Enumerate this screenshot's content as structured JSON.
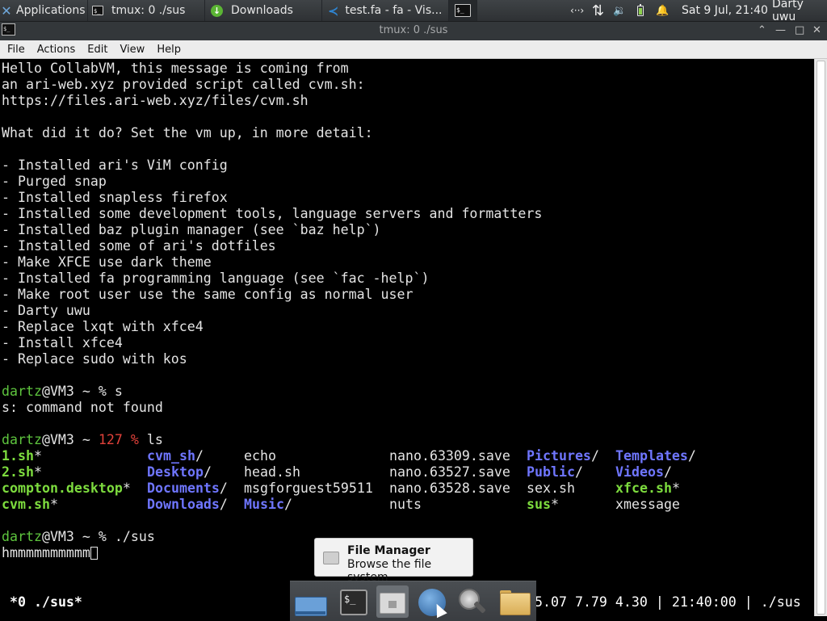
{
  "panel": {
    "applications_label": "Applications",
    "tasks": [
      {
        "label": "tmux: 0 ./sus",
        "icon": "terminal-icon"
      },
      {
        "label": "Downloads",
        "icon": "download-icon"
      },
      {
        "label": "test.fa - fa - Vis...",
        "icon": "vscode-icon"
      },
      {
        "label": "",
        "icon": "terminal-icon"
      }
    ],
    "tray": {
      "network": "‹··›",
      "transfer": "⇅",
      "volume": "🔉",
      "bell": "🔔",
      "clock": "Sat  9 Jul, 21:40",
      "user": "Darty uwu"
    }
  },
  "window": {
    "title": "tmux: 0 ./sus",
    "controls": {
      "shade": "⌃",
      "minimize": "—",
      "maximize": "□",
      "close": "✕"
    }
  },
  "menu": [
    "File",
    "Actions",
    "Edit",
    "View",
    "Help"
  ],
  "terminal": {
    "lines": [
      "Hello CollabVM, this message is coming from",
      "an ari-web.xyz provided script called cvm.sh:",
      "https://files.ari-web.xyz/files/cvm.sh",
      "",
      "What did it do? Set the vm up, in more detail:",
      "",
      "- Installed ari's ViM config",
      "- Purged snap",
      "- Installed snapless firefox",
      "- Installed some development tools, language servers and formatters",
      "- Installed baz plugin manager (see `baz help`)",
      "- Installed some of ari's dotfiles",
      "- Make XFCE use dark theme",
      "- Installed fa programming language (see `fac -help`)",
      "- Make root user use the same config as normal user",
      "- Darty uwu",
      "- Replace lxqt with xfce4",
      "- Install xfce4",
      "- Replace sudo with kos"
    ],
    "prompt1": {
      "user": "dartz",
      "rest": "@VM3 ~ % s"
    },
    "error_line": "s: command not found",
    "prompt2": {
      "user": "dartz",
      "mid": "@VM3 ~ ",
      "code": "127 %",
      "cmd": " ls"
    },
    "ls_columns": [
      [
        {
          "name": "1.sh",
          "suffix": "*",
          "kind": "exe"
        },
        {
          "name": "2.sh",
          "suffix": "*",
          "kind": "exe"
        },
        {
          "name": "compton.desktop",
          "suffix": "*",
          "kind": "exe"
        },
        {
          "name": "cvm.sh",
          "suffix": "*",
          "kind": "exe"
        }
      ],
      [
        {
          "name": "cvm_sh",
          "suffix": "/",
          "kind": "dir"
        },
        {
          "name": "Desktop",
          "suffix": "/",
          "kind": "dir"
        },
        {
          "name": "Documents",
          "suffix": "/",
          "kind": "dir"
        },
        {
          "name": "Downloads",
          "suffix": "/",
          "kind": "dir"
        }
      ],
      [
        {
          "name": "echo",
          "suffix": "",
          "kind": "plain"
        },
        {
          "name": "head.sh",
          "suffix": "",
          "kind": "plain"
        },
        {
          "name": "msgforguest59511",
          "suffix": "",
          "kind": "plain"
        },
        {
          "name": "Music",
          "suffix": "/",
          "kind": "dir"
        }
      ],
      [
        {
          "name": "nano.63309.save",
          "suffix": "",
          "kind": "plain"
        },
        {
          "name": "nano.63527.save",
          "suffix": "",
          "kind": "plain"
        },
        {
          "name": "nano.63528.save",
          "suffix": "",
          "kind": "plain"
        },
        {
          "name": "nuts",
          "suffix": "",
          "kind": "plain"
        }
      ],
      [
        {
          "name": "Pictures",
          "suffix": "/",
          "kind": "dir"
        },
        {
          "name": "Public",
          "suffix": "/",
          "kind": "dir"
        },
        {
          "name": "sex.sh",
          "suffix": "",
          "kind": "plain"
        },
        {
          "name": "sus",
          "suffix": "*",
          "kind": "exe"
        }
      ],
      [
        {
          "name": "Templates",
          "suffix": "/",
          "kind": "dir"
        },
        {
          "name": "Videos",
          "suffix": "/",
          "kind": "dir"
        },
        {
          "name": "xfce.sh",
          "suffix": "*",
          "kind": "exe"
        },
        {
          "name": "xmessage",
          "suffix": "",
          "kind": "plain"
        }
      ]
    ],
    "prompt3": {
      "user": "dartz",
      "rest": "@VM3 ~ % ./sus"
    },
    "input_line": "hmmmmmmmmmm"
  },
  "tmux_status": {
    "window": "*0 ./sus*",
    "right": "5.07 7.79 4.30 | 21:40:00 | ./sus"
  },
  "tooltip": {
    "title": "File Manager",
    "subtitle": "Browse the file system"
  },
  "dock": [
    {
      "name": "show-desktop",
      "icon": "show-desktop-icon"
    },
    {
      "name": "terminal",
      "icon": "terminal-icon"
    },
    {
      "name": "file-manager",
      "icon": "home-folder-icon"
    },
    {
      "name": "web-browser",
      "icon": "globe-icon"
    },
    {
      "name": "app-finder",
      "icon": "magnifier-icon"
    },
    {
      "name": "folder",
      "icon": "folder-icon"
    }
  ],
  "colors": {
    "user_prompt": "#5ec53e",
    "error_code": "#e0413a",
    "executable": "#7ddc3e",
    "directory": "#6f76ff"
  }
}
